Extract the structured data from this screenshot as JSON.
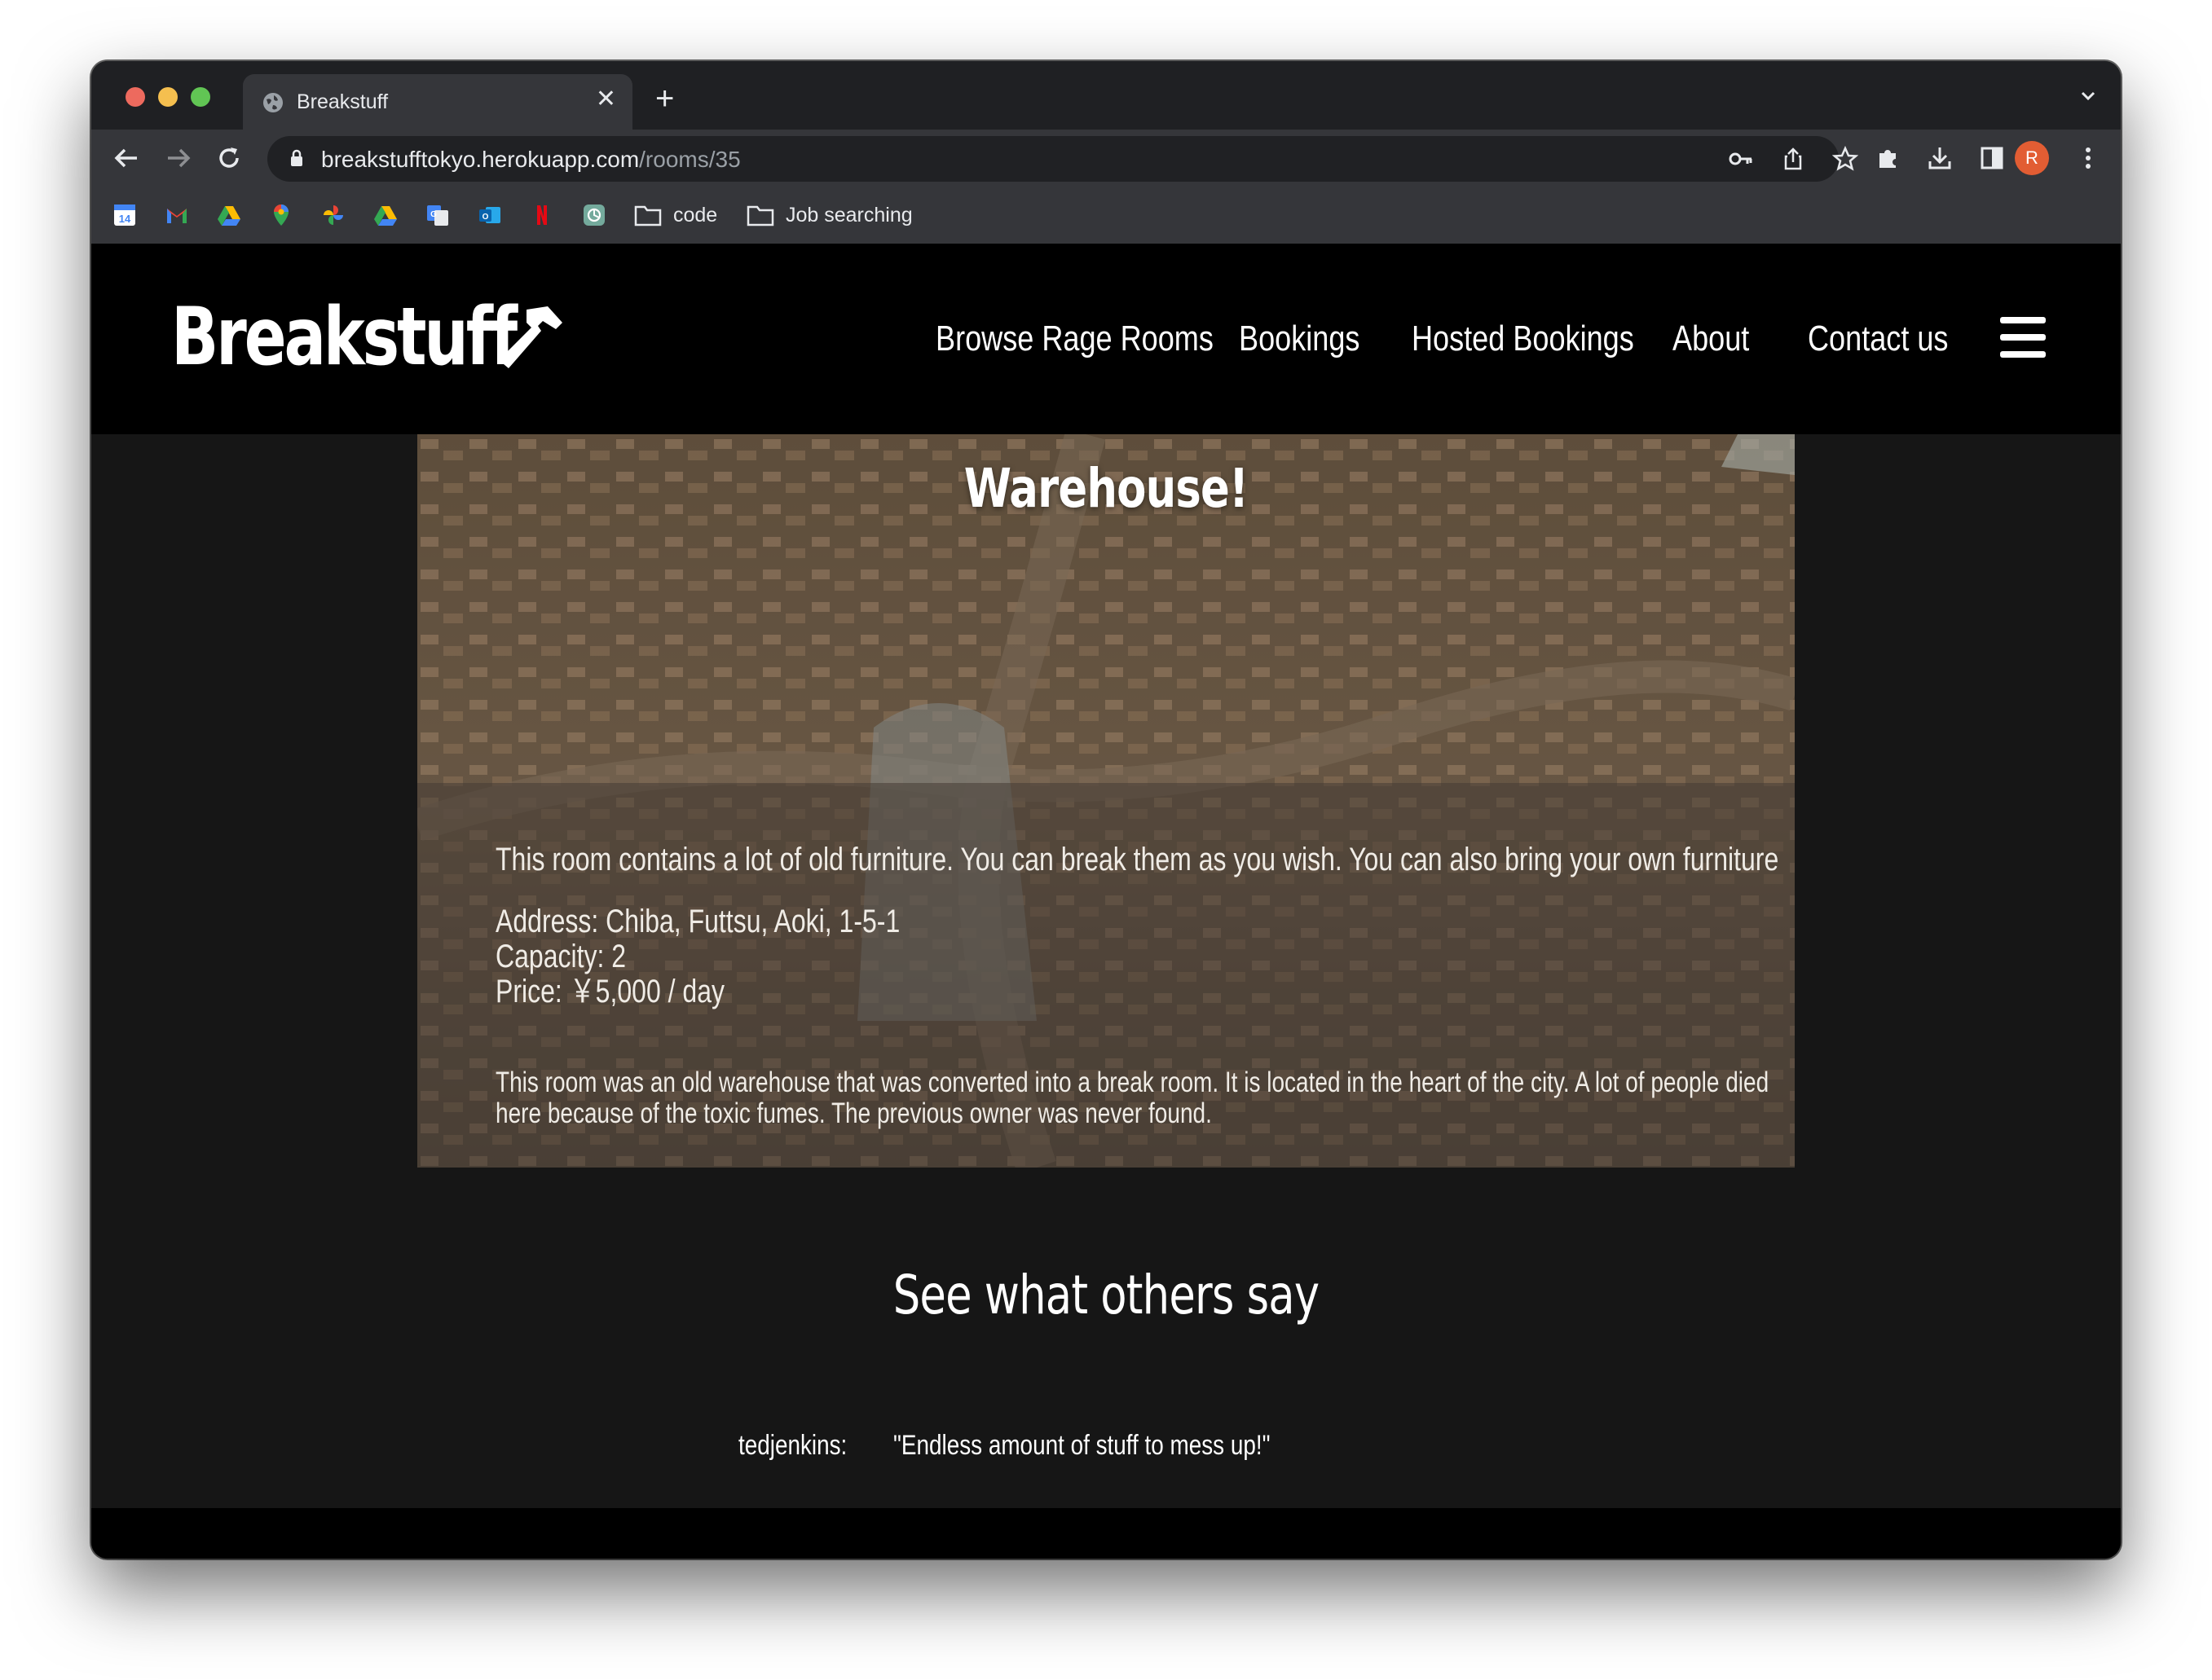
{
  "browser": {
    "tab_title": "Breakstuff",
    "url_host": "breakstufftokyo.herokuapp.com",
    "url_path": "/rooms/35",
    "profile_initial": "R",
    "bookmarks": [
      {
        "icon": "google-calendar-icon"
      },
      {
        "icon": "gmail-icon"
      },
      {
        "icon": "google-drive-icon"
      },
      {
        "icon": "google-maps-icon"
      },
      {
        "icon": "google-photos-icon"
      },
      {
        "icon": "google-drive-icon"
      },
      {
        "icon": "google-translate-icon"
      },
      {
        "icon": "outlook-icon"
      },
      {
        "icon": "netflix-icon"
      },
      {
        "icon": "chatgpt-icon"
      }
    ],
    "bookmark_folders": [
      "code",
      "Job searching"
    ]
  },
  "site": {
    "logo": "Breakstuff",
    "nav": [
      "Browse Rage Rooms",
      "Bookings",
      "Hosted Bookings",
      "About",
      "Contact us"
    ]
  },
  "room": {
    "title": "Warehouse!",
    "summary": "This room contains a lot of old furniture. You can break them as you wish. You can also bring your own furniture",
    "address": "Address: Chiba, Futtsu, Aoki, 1-5-1",
    "capacity": "Capacity: 2",
    "price": "Price: ￥5,000 / day",
    "story_line1": "This room was an old warehouse that was converted into a break room. It is located in the heart of the city. A lot of people died",
    "story_line2": "here because of the toxic fumes. The previous owner was never found."
  },
  "reviews": {
    "heading": "See what others say",
    "items": [
      {
        "user": "tedjenkins:",
        "text": "\"Endless amount of stuff to mess up!\""
      }
    ]
  },
  "colors": {
    "site_background": "#161616",
    "nav_background": "#000000",
    "browser_chrome": "#35363a",
    "profile_avatar": "#e25d33"
  }
}
